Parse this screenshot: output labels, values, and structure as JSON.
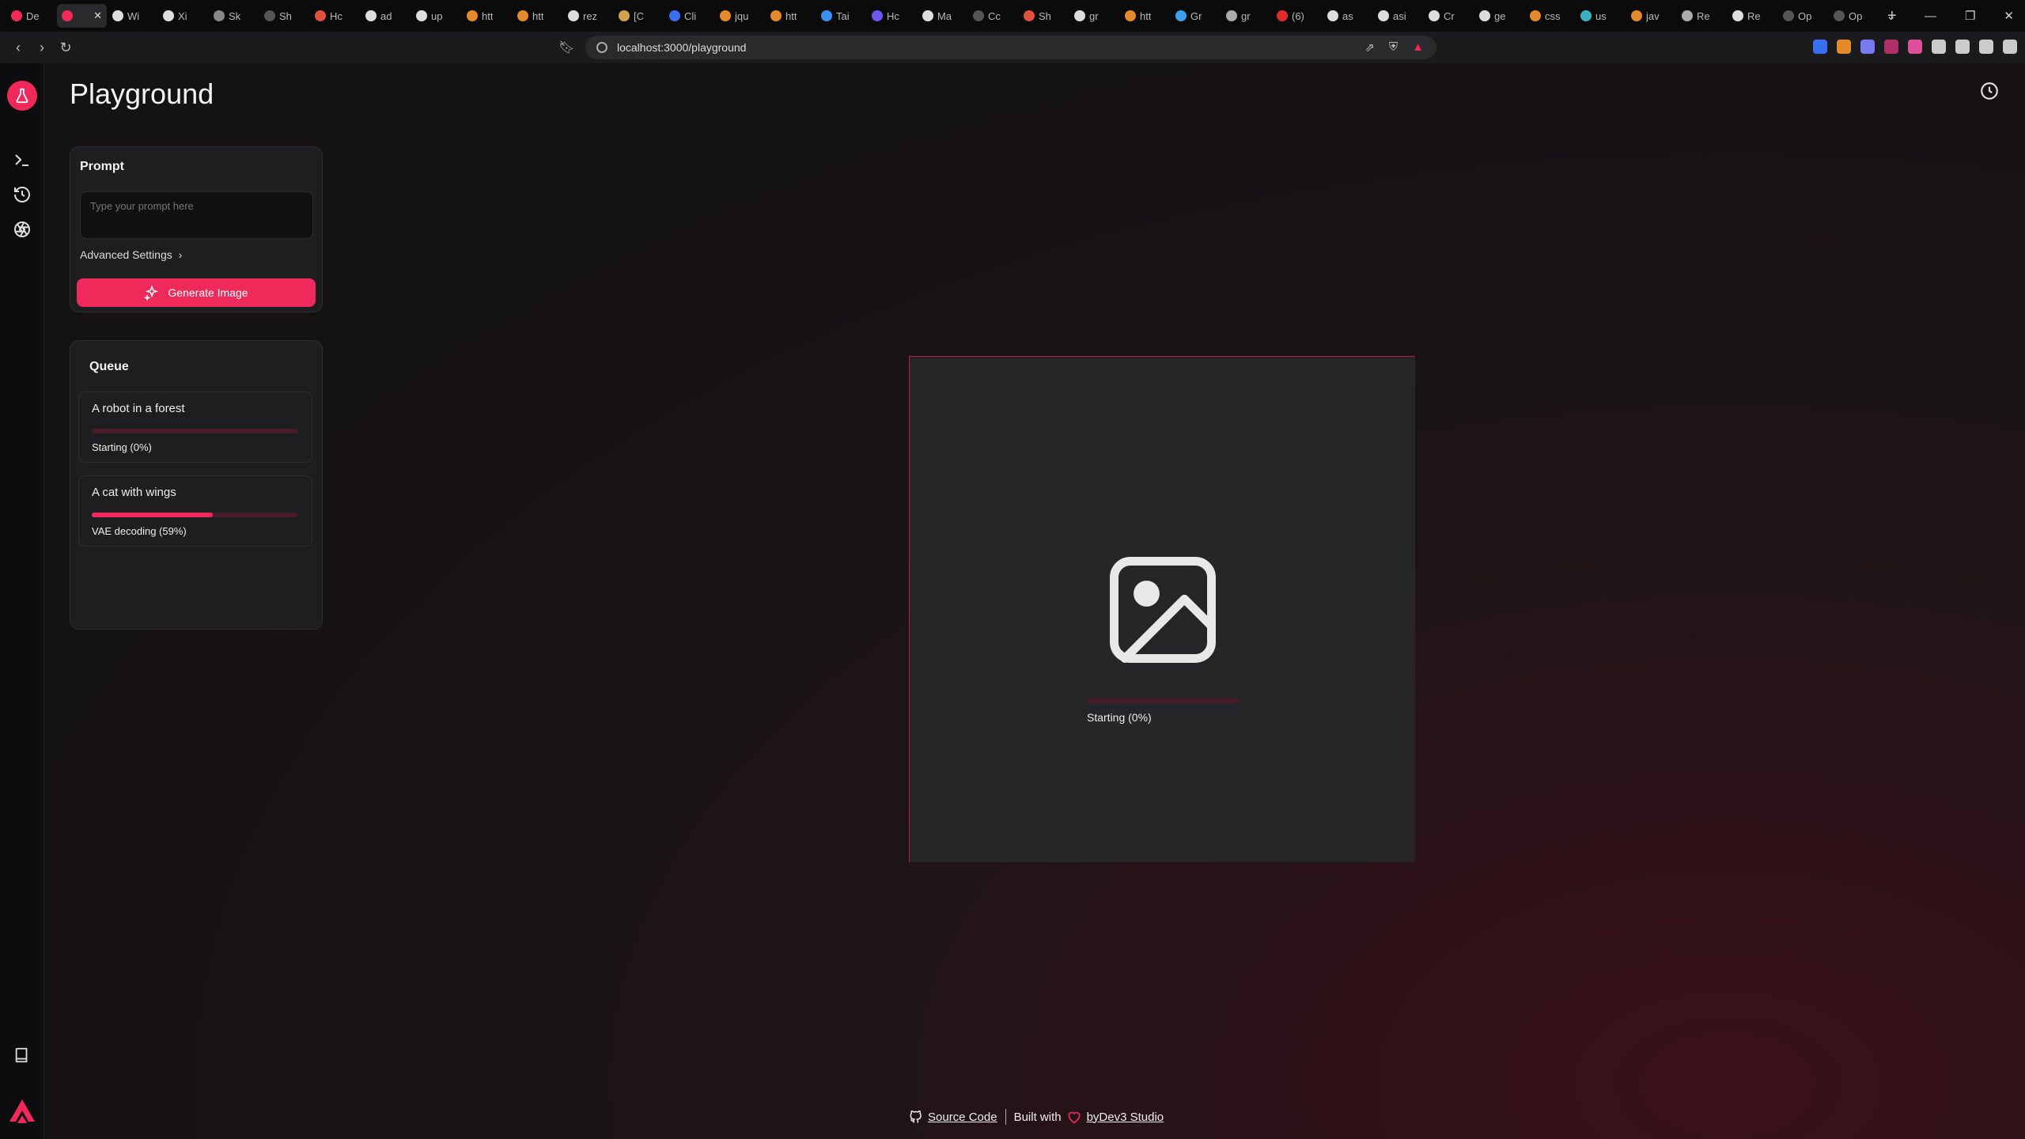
{
  "browser": {
    "tabs": [
      {
        "label": "De",
        "color": "#f0295b"
      },
      {
        "label": "",
        "color": "#f0295b",
        "active": true
      },
      {
        "label": "Wi",
        "color": "#dddddd"
      },
      {
        "label": "Xi",
        "color": "#dddddd"
      },
      {
        "label": "Sk",
        "color": "#888888"
      },
      {
        "label": "Sh",
        "color": "#555555"
      },
      {
        "label": "Hc",
        "color": "#e0533a"
      },
      {
        "label": "ad",
        "color": "#dddddd"
      },
      {
        "label": "up",
        "color": "#dddddd"
      },
      {
        "label": "htt",
        "color": "#e48a2b"
      },
      {
        "label": "htt",
        "color": "#e48a2b"
      },
      {
        "label": "rez",
        "color": "#dddddd"
      },
      {
        "label": "[C",
        "color": "#d2a24c"
      },
      {
        "label": "Cli",
        "color": "#3a6ff0"
      },
      {
        "label": "jqu",
        "color": "#e48a2b"
      },
      {
        "label": "htt",
        "color": "#e48a2b"
      },
      {
        "label": "Tai",
        "color": "#3a8ff0"
      },
      {
        "label": "Hc",
        "color": "#6a5af0"
      },
      {
        "label": "Ma",
        "color": "#dddddd"
      },
      {
        "label": "Cc",
        "color": "#555555"
      },
      {
        "label": "Sh",
        "color": "#e0533a"
      },
      {
        "label": "gr",
        "color": "#dddddd"
      },
      {
        "label": "htt",
        "color": "#e48a2b"
      },
      {
        "label": "Gr",
        "color": "#3aa0f0"
      },
      {
        "label": "gr",
        "color": "#aaaaaa"
      },
      {
        "label": "(6)",
        "color": "#e02b2b"
      },
      {
        "label": "as",
        "color": "#dddddd"
      },
      {
        "label": "asi",
        "color": "#dddddd"
      },
      {
        "label": "Cr",
        "color": "#dddddd"
      },
      {
        "label": "ge",
        "color": "#dddddd"
      },
      {
        "label": "css",
        "color": "#e48a2b"
      },
      {
        "label": "us",
        "color": "#3ab0c0"
      },
      {
        "label": "jav",
        "color": "#e48a2b"
      },
      {
        "label": "Re",
        "color": "#aaaaaa"
      },
      {
        "label": "Re",
        "color": "#dddddd"
      },
      {
        "label": "Op",
        "color": "#555555"
      },
      {
        "label": "Op",
        "color": "#555555"
      }
    ],
    "url": "localhost:3000/playground",
    "extension_colors": [
      "#3a6ff0",
      "#e48a2b",
      "#7a7af0",
      "#b0306a",
      "#e0509a",
      "#cccccc",
      "#cccccc",
      "#cccccc",
      "#cccccc"
    ]
  },
  "page": {
    "title": "Playground"
  },
  "prompt": {
    "title": "Prompt",
    "placeholder": "Type your prompt here",
    "advanced_label": "Advanced Settings",
    "generate_label": "Generate Image"
  },
  "queue": {
    "title": "Queue",
    "items": [
      {
        "title": "A robot in a forest",
        "status": "Starting (0%)",
        "progress": 0
      },
      {
        "title": "A cat with wings",
        "status": "VAE decoding (59%)",
        "progress": 0.59
      }
    ]
  },
  "preview": {
    "status": "Starting (0%)",
    "progress": 0
  },
  "footer": {
    "source_label": "Source Code",
    "built_with": "Built with",
    "by_label": "byDev3 Studio"
  },
  "colors": {
    "accent": "#f0295b",
    "track": "#4a1c27"
  }
}
